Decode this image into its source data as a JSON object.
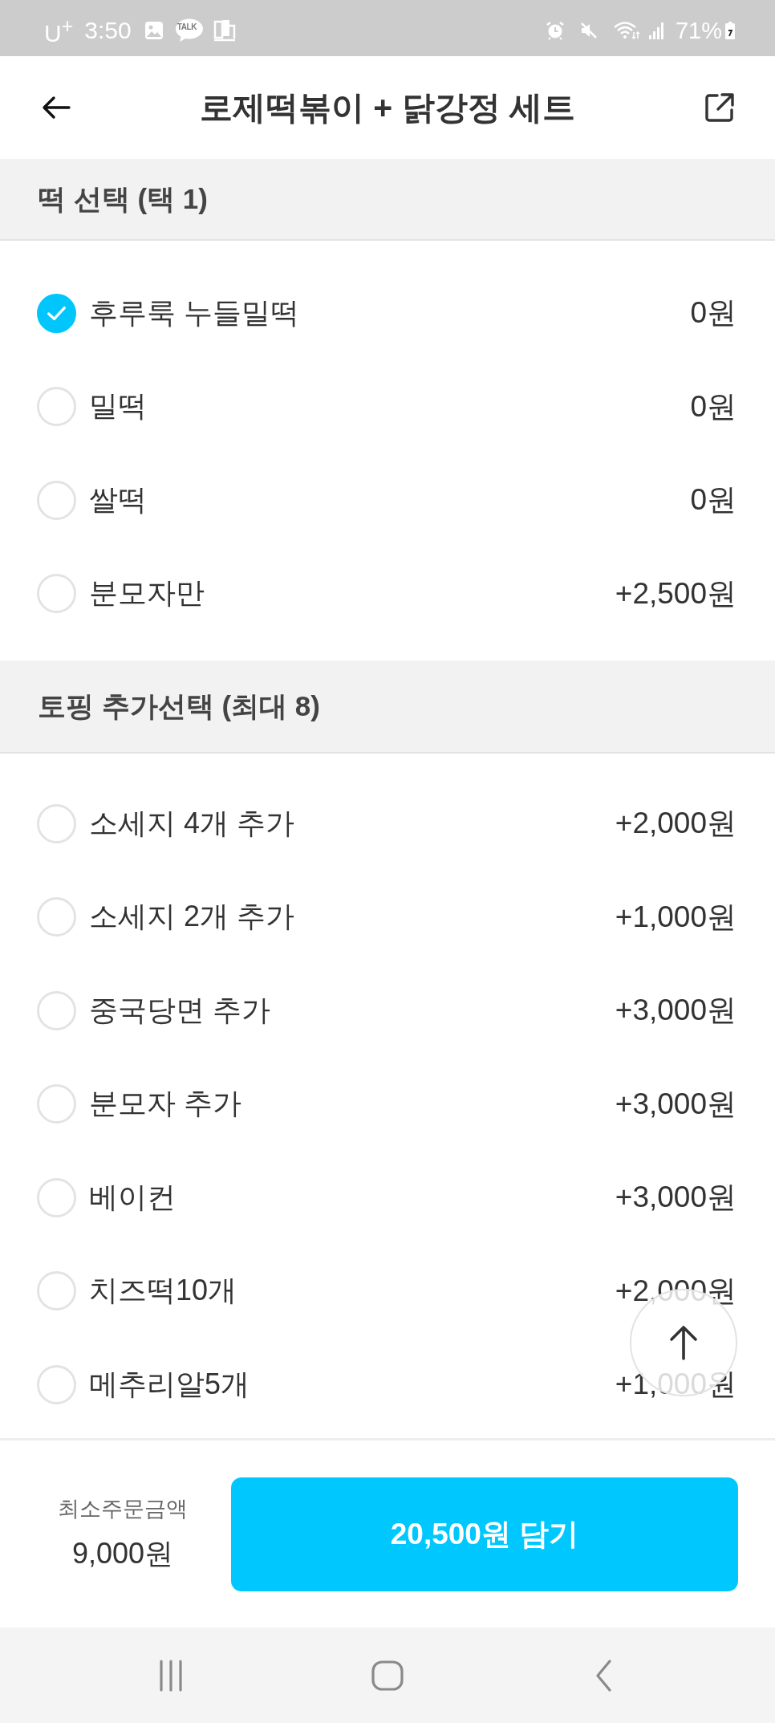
{
  "status_bar": {
    "carrier": "U$^{+}$",
    "time": "3:50",
    "talk_icon_label": "TALK",
    "battery_percent": "71%"
  },
  "header": {
    "title": "로제떡볶이 + 닭강정 세트"
  },
  "option_groups": [
    {
      "title": "떡 선택 (택 1)",
      "kind": "single",
      "options": [
        {
          "label": "후루룩 누들밀떡",
          "price": "0원",
          "selected": true
        },
        {
          "label": "밀떡",
          "price": "0원",
          "selected": false
        },
        {
          "label": "쌀떡",
          "price": "0원",
          "selected": false
        },
        {
          "label": "분모자만",
          "price": "+2,500원",
          "selected": false
        }
      ]
    },
    {
      "title": "토핑 추가선택 (최대 8)",
      "kind": "multi",
      "options": [
        {
          "label": "소세지 4개 추가",
          "price": "+2,000원",
          "checked": false
        },
        {
          "label": "소세지 2개 추가",
          "price": "+1,000원",
          "checked": false
        },
        {
          "label": "중국당면 추가",
          "price": "+3,000원",
          "checked": false
        },
        {
          "label": "분모자 추가",
          "price": "+3,000원",
          "checked": false
        },
        {
          "label": "베이컨",
          "price": "+3,000원",
          "checked": false
        },
        {
          "label": "치즈떡10개",
          "price": "+2,000원",
          "checked": false
        },
        {
          "label": "메추리알5개",
          "price": "+1,000원",
          "checked": false
        }
      ]
    }
  ],
  "footer": {
    "min_order_label": "최소주문금액",
    "min_order_amount": "9,000원",
    "add_button": "20,500원 담기"
  }
}
